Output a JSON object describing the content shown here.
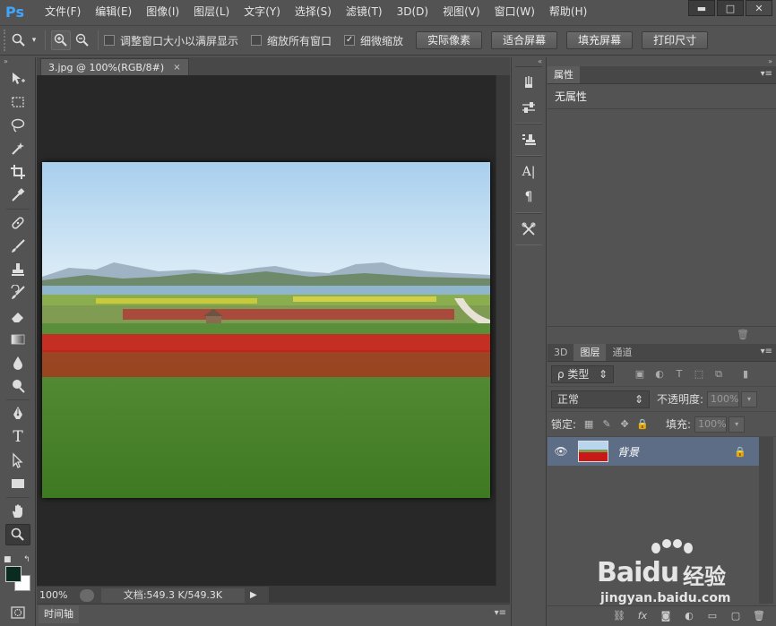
{
  "app": {
    "logo": "Ps"
  },
  "menu": [
    "文件(F)",
    "编辑(E)",
    "图像(I)",
    "图层(L)",
    "文字(Y)",
    "选择(S)",
    "滤镜(T)",
    "3D(D)",
    "视图(V)",
    "窗口(W)",
    "帮助(H)"
  ],
  "window_controls": {
    "minimize": "▬",
    "maximize": "□",
    "close": "✕"
  },
  "options": {
    "resize_window": "调整窗口大小以满屏显示",
    "zoom_all": "缩放所有窗口",
    "scrubby_zoom": "细微缩放",
    "scrubby_checked": "✓",
    "btn_actual": "实际像素",
    "btn_fit": "适合屏幕",
    "btn_fill": "填充屏幕",
    "btn_print": "打印尺寸"
  },
  "document": {
    "tab_title": "3.jpg @ 100%(RGB/8#)",
    "tab_close": "×",
    "zoom": "100%",
    "doc_info": "文档:549.3 K/549.3K",
    "status_arrow": "▶"
  },
  "timeline": {
    "tab": "时间轴",
    "menu": "▾≡"
  },
  "properties": {
    "tab": "属性",
    "menu": "▾≡",
    "content": "无属性"
  },
  "layers": {
    "tabs": [
      "3D",
      "图层",
      "通道"
    ],
    "menu": "▾≡",
    "filter_kind": "ρ 类型",
    "blend_mode": "正常",
    "opacity_label": "不透明度:",
    "opacity_value": "100%",
    "lock_label": "锁定:",
    "fill_label": "填充:",
    "fill_value": "100%",
    "layer_name": "背景"
  },
  "watermark": {
    "brand": "Baidu",
    "brand_cn": "经验",
    "url": "jingyan.baidu.com"
  },
  "colors": {
    "foreground": "#0b2a20",
    "background": "#ffffff",
    "selected_layer": "#5e6d86"
  }
}
